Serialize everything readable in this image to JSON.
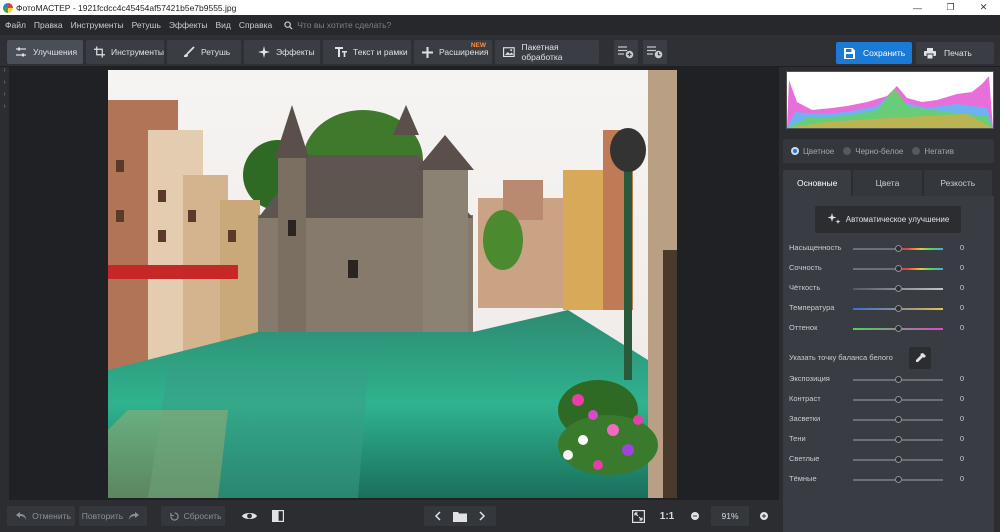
{
  "window": {
    "title": "ФотоМАСТЕР - 1921fcdcc4c45454af57421b5e7b9555.jpg",
    "controls": [
      "—",
      "❐",
      "✕"
    ]
  },
  "menu": {
    "items": [
      "Файл",
      "Правка",
      "Инструменты",
      "Ретушь",
      "Эффекты",
      "Вид",
      "Справка"
    ],
    "search_placeholder": "Что вы хотите сделать?"
  },
  "toolbar": {
    "tabs": [
      {
        "label": "Улучшения",
        "icon": "sliders-icon"
      },
      {
        "label": "Инструменты",
        "icon": "crop-icon"
      },
      {
        "label": "Ретушь",
        "icon": "brush-icon"
      },
      {
        "label": "Эффекты",
        "icon": "sparkle-icon"
      },
      {
        "label": "Текст и рамки",
        "icon": "text-icon"
      },
      {
        "label": "Расширения",
        "icon": "plus-icon",
        "badge": "NEW"
      },
      {
        "label": "Пакетная обработка",
        "icon": "image-stack-icon"
      }
    ],
    "save_label": "Сохранить",
    "print_label": "Печать"
  },
  "bottom": {
    "undo_label": "Отменить",
    "redo_label": "Повторить",
    "reset_label": "Сбросить",
    "zoom_one": "1:1",
    "zoom_value": "91%"
  },
  "panel": {
    "modes": [
      {
        "label": "Цветное",
        "selected": true
      },
      {
        "label": "Черно-белое",
        "selected": false
      },
      {
        "label": "Негатив",
        "selected": false
      }
    ],
    "tabs": [
      "Основные",
      "Цвета",
      "Резкость"
    ],
    "auto_label": "Автоматическое улучшение",
    "sliders_a": [
      {
        "label": "Насыщенность",
        "value": "0"
      },
      {
        "label": "Сочность",
        "value": "0"
      },
      {
        "label": "Чёткость",
        "value": "0"
      },
      {
        "label": "Температура",
        "value": "0"
      },
      {
        "label": "Оттенок",
        "value": "0"
      }
    ],
    "wb_label": "Указать точку баланса белого",
    "sliders_b": [
      {
        "label": "Экспозиция",
        "value": "0"
      },
      {
        "label": "Контраст",
        "value": "0"
      },
      {
        "label": "Засветки",
        "value": "0"
      },
      {
        "label": "Тени",
        "value": "0"
      },
      {
        "label": "Светлые",
        "value": "0"
      },
      {
        "label": "Тёмные",
        "value": "0"
      }
    ]
  },
  "colors": {
    "accent": "#1a7ad6",
    "new_badge": "#ff8a3d",
    "background": "#2b2d31"
  }
}
